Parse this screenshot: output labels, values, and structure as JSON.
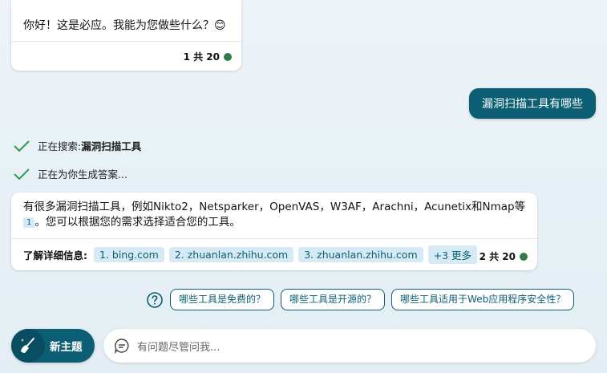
{
  "greeting": {
    "text": "你好！这是必应。我能为您做些什么？😊",
    "count": "1 共 20"
  },
  "user_message": "漏洞扫描工具有哪些",
  "status": [
    {
      "prefix": "正在搜索: ",
      "bold": "漏洞扫描工具"
    },
    {
      "prefix": "正在为你生成答案...",
      "bold": ""
    }
  ],
  "answer": {
    "text_1": "有很多漏洞扫描工具，例如Nikto2，Netsparker，OpenVAS，W3AF，Arachni，Acunetix和Nmap等",
    "citation": "1",
    "text_2": "。您可以根据您的需求选择适合您的工具。",
    "learn_more_label": "了解详细信息:",
    "sources": [
      "1. bing.com",
      "2. zhuanlan.zhihu.com",
      "3. zhuanlan.zhihu.com"
    ],
    "more": "+3 更多",
    "count": "2 共 20"
  },
  "suggestions": [
    "哪些工具是免费的？",
    "哪些工具是开源的？",
    "哪些工具适用于Web应用程序安全性？"
  ],
  "new_topic_label": "新主题",
  "input_placeholder": "有问题尽管问我...",
  "colors": {
    "accent": "#0b5e73",
    "status_green": "#2e7d4b",
    "check_green": "#2e9b55"
  }
}
